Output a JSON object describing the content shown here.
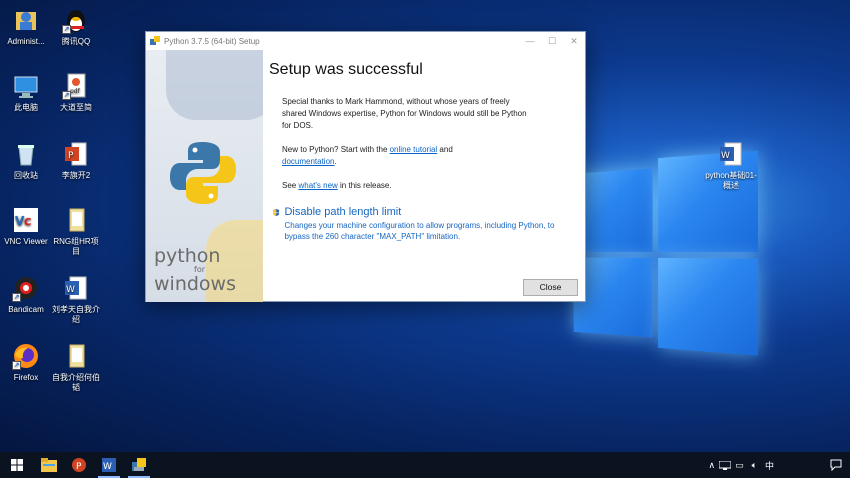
{
  "desktop": {
    "icons": [
      {
        "label": "Administ..."
      },
      {
        "label": "腾讯QQ"
      },
      {
        "label": "此电脑"
      },
      {
        "label": "大道至简"
      },
      {
        "label": "回收站"
      },
      {
        "label": "李旗开2"
      },
      {
        "label": "VNC Viewer"
      },
      {
        "label": "RNG组HR项目"
      },
      {
        "label": "Bandicam"
      },
      {
        "label": "刘孝天自我介绍"
      },
      {
        "label": "Firefox"
      },
      {
        "label": "自我介绍何伯韬"
      },
      {
        "label": "python基础01-概述"
      }
    ]
  },
  "dialog": {
    "window_title": "Python 3.7.5 (64-bit) Setup",
    "sidebar_logo": {
      "line1": "python",
      "line2": "for",
      "line3": "windows"
    },
    "heading": "Setup was successful",
    "thanks_text": "Special thanks to Mark Hammond, without whose years of freely shared Windows expertise, Python for Windows would still be Python for DOS.",
    "new_prefix": "New to Python? Start with the ",
    "online_tutorial_link": "online tutorial",
    "new_and": " and ",
    "documentation_link": "documentation",
    "new_suffix": ".",
    "see_prefix": "See ",
    "whats_new_link": "what's new",
    "see_suffix": " in this release.",
    "option_title": "Disable path length limit",
    "option_desc": "Changes your machine configuration to allow programs, including Python, to bypass the 260 character \"MAX_PATH\" limitation.",
    "close_label": "Close"
  },
  "taskbar": {
    "tray_ime": "中"
  },
  "colors": {
    "link": "#0b64c8",
    "accent": "#1766c2",
    "taskbar": "#0b1220"
  }
}
